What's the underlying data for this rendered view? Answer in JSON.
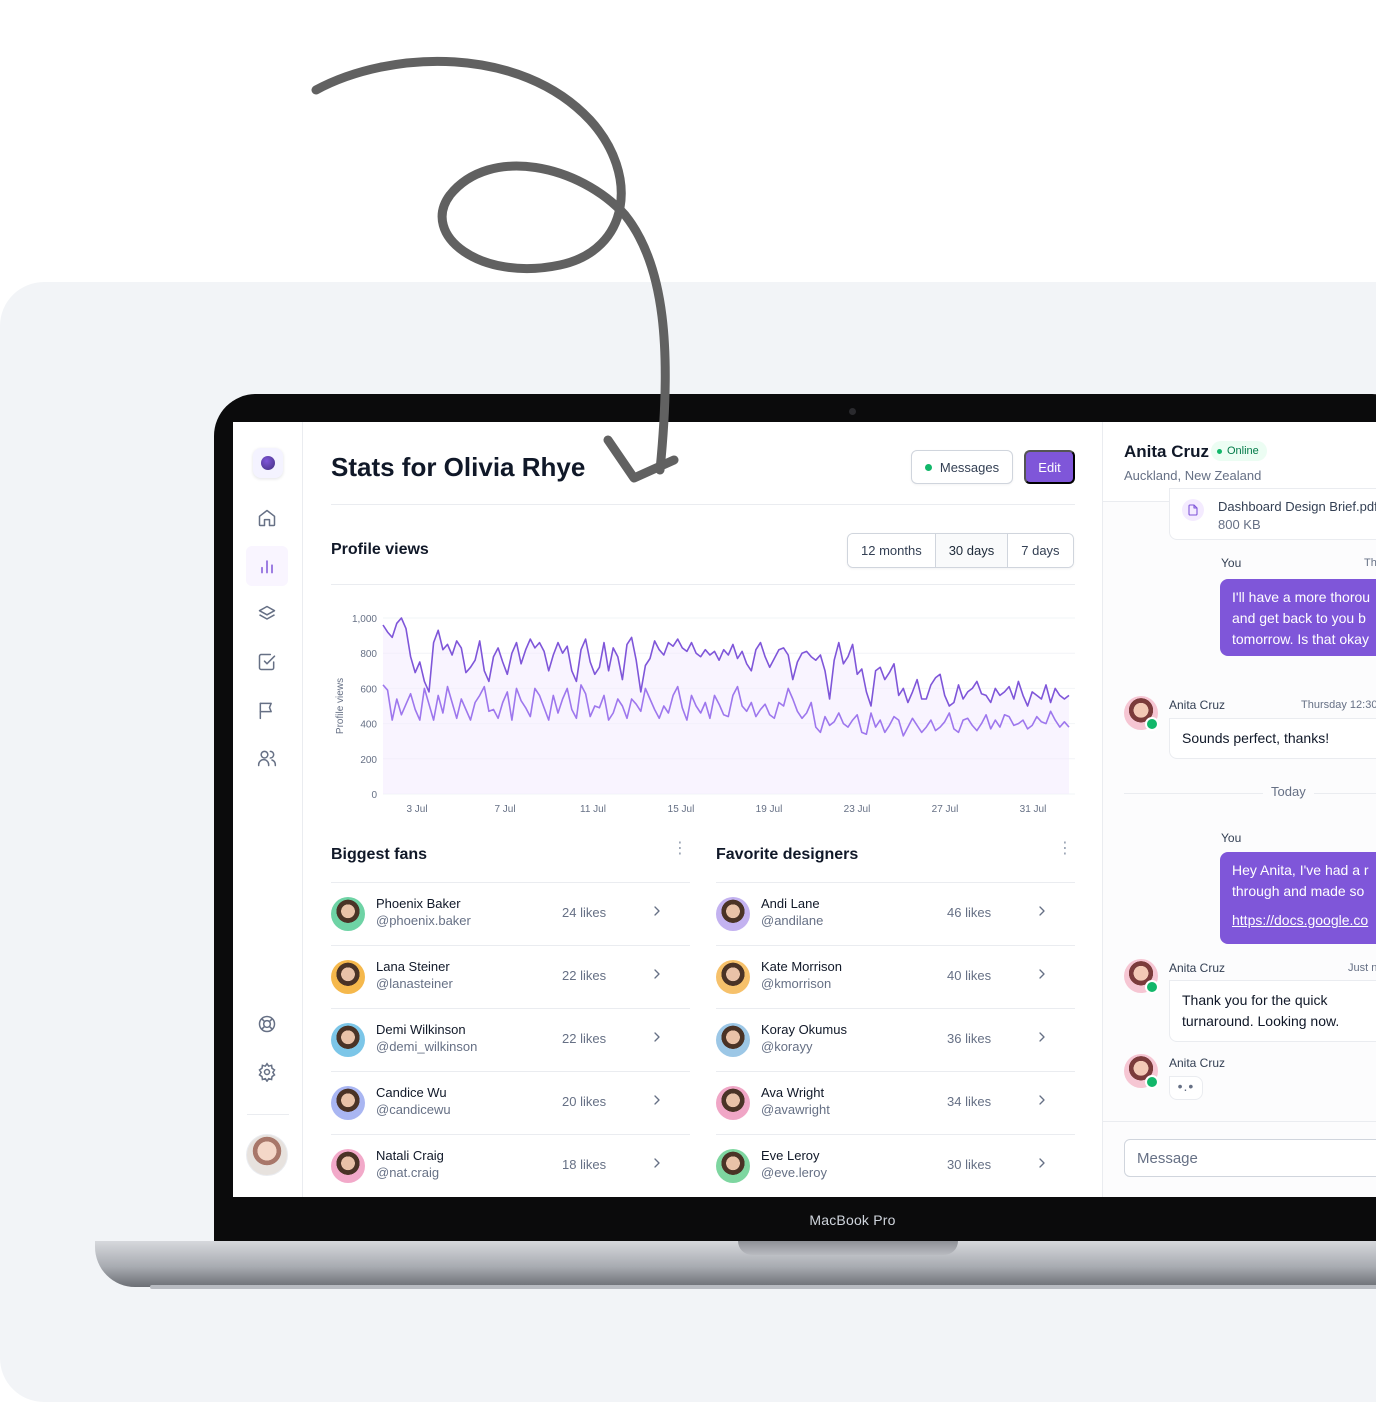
{
  "page": {
    "title": "Stats for Olivia Rhye",
    "messages_label": "Messages",
    "edit_label": "Edit"
  },
  "device": {
    "label": "MacBook Pro"
  },
  "sidebar": {
    "items": [
      {
        "name": "home",
        "icon": "home-icon"
      },
      {
        "name": "stats",
        "icon": "bar-chart-icon",
        "active": true
      },
      {
        "name": "layers",
        "icon": "layers-icon"
      },
      {
        "name": "tasks",
        "icon": "check-square-icon"
      },
      {
        "name": "reports",
        "icon": "flag-icon"
      },
      {
        "name": "users",
        "icon": "users-icon"
      }
    ],
    "footer_items": [
      {
        "name": "support",
        "icon": "life-buoy-icon"
      },
      {
        "name": "settings",
        "icon": "settings-icon"
      }
    ]
  },
  "profile_views": {
    "title": "Profile views",
    "ranges": [
      "12 months",
      "30 days",
      "7 days"
    ],
    "selected_range": "30 days"
  },
  "chart_data": {
    "type": "line",
    "ylabel": "Profile views",
    "ylim": [
      0,
      1000
    ],
    "yticks": [
      "0",
      "200",
      "400",
      "600",
      "800",
      "1,000"
    ],
    "xticks": [
      "3 Jul",
      "7 Jul",
      "11 Jul",
      "15 Jul",
      "19 Jul",
      "23 Jul",
      "27 Jul",
      "31 Jul"
    ],
    "x_start": "1 Jul",
    "x_end": "1 Aug",
    "colors": {
      "upper": "#7f56d9",
      "lower": "#9e77ed",
      "fill": "#f4ebff"
    },
    "series": [
      {
        "values": [
          960,
          920,
          890,
          970,
          1000,
          940,
          780,
          690,
          750,
          640,
          580,
          860,
          930,
          820,
          850,
          790,
          870,
          830,
          690,
          720,
          760,
          870,
          700,
          640,
          780,
          830,
          750,
          680,
          800,
          860,
          740,
          820,
          880,
          830,
          860,
          810,
          700,
          790,
          860,
          800,
          840,
          700,
          640,
          820,
          880,
          750,
          680,
          720,
          860,
          700,
          830,
          780,
          650,
          850,
          890,
          760,
          580,
          730,
          770,
          870,
          820,
          790,
          860,
          840,
          880,
          830,
          810,
          860,
          800,
          780,
          820,
          790,
          810,
          760,
          820,
          790,
          850,
          770,
          810,
          740,
          700,
          820,
          860,
          780,
          720,
          770,
          820,
          830,
          790,
          650,
          750,
          800,
          810,
          780,
          760,
          790,
          700,
          540,
          760,
          860,
          740,
          780,
          850,
          680,
          710,
          580,
          500,
          700,
          720,
          650,
          690,
          740,
          560,
          600,
          520,
          580,
          650,
          540,
          540,
          620,
          660,
          680,
          560,
          500,
          520,
          620,
          540,
          580,
          600,
          640,
          570,
          560,
          520,
          600,
          560,
          580,
          610,
          540,
          640,
          560,
          500,
          580,
          560,
          540,
          620,
          520,
          600,
          560,
          540,
          560
        ]
      },
      {
        "values": [
          620,
          590,
          420,
          540,
          450,
          510,
          570,
          480,
          420,
          600,
          510,
          420,
          560,
          460,
          610,
          520,
          430,
          540,
          480,
          420,
          520,
          560,
          610,
          470,
          480,
          430,
          520,
          580,
          420,
          600,
          530,
          490,
          440,
          600,
          560,
          490,
          420,
          560,
          460,
          540,
          600,
          480,
          430,
          620,
          570,
          440,
          500,
          490,
          560,
          420,
          460,
          540,
          500,
          430,
          540,
          510,
          470,
          600,
          540,
          480,
          430,
          500,
          460,
          560,
          610,
          490,
          420,
          560,
          500,
          460,
          520,
          430,
          560,
          510,
          450,
          440,
          560,
          610,
          500,
          470,
          520,
          440,
          480,
          510,
          450,
          430,
          520,
          500,
          600,
          540,
          470,
          430,
          460,
          520,
          380,
          350,
          440,
          390,
          410,
          460,
          400,
          380,
          420,
          450,
          350,
          340,
          460,
          380,
          420,
          350,
          390,
          440,
          420,
          330,
          380,
          430,
          390,
          350,
          380,
          420,
          360,
          380,
          410,
          460,
          370,
          350,
          420,
          430,
          390,
          360,
          400,
          450,
          370,
          420,
          380,
          450,
          440,
          390,
          400,
          420,
          370,
          390,
          440,
          410,
          400,
          470,
          420,
          380,
          410,
          380
        ]
      }
    ]
  },
  "biggest_fans": {
    "title": "Biggest fans",
    "rows": [
      {
        "name": "Phoenix Baker",
        "handle": "@phoenix.baker",
        "likes": "24 likes",
        "avatar_color": "#6ed3a5"
      },
      {
        "name": "Lana Steiner",
        "handle": "@lanasteiner",
        "likes": "22 likes",
        "avatar_color": "#f5b84c"
      },
      {
        "name": "Demi Wilkinson",
        "handle": "@demi_wilkinson",
        "likes": "22 likes",
        "avatar_color": "#7cc6e8"
      },
      {
        "name": "Candice Wu",
        "handle": "@candicewu",
        "likes": "20 likes",
        "avatar_color": "#a9b6f2"
      },
      {
        "name": "Natali Craig",
        "handle": "@nat.craig",
        "likes": "18 likes",
        "avatar_color": "#f2a9c9"
      }
    ]
  },
  "favorite_designers": {
    "title": "Favorite designers",
    "rows": [
      {
        "name": "Andi Lane",
        "handle": "@andilane",
        "likes": "46 likes",
        "avatar_color": "#c3b2f0"
      },
      {
        "name": "Kate Morrison",
        "handle": "@kmorrison",
        "likes": "40 likes",
        "avatar_color": "#f6c16b"
      },
      {
        "name": "Koray Okumus",
        "handle": "@korayy",
        "likes": "36 likes",
        "avatar_color": "#9cc7e6"
      },
      {
        "name": "Ava Wright",
        "handle": "@avawright",
        "likes": "34 likes",
        "avatar_color": "#f0a6c6"
      },
      {
        "name": "Eve Leroy",
        "handle": "@eve.leroy",
        "likes": "30 likes",
        "avatar_color": "#7ed6a0"
      }
    ]
  },
  "chat": {
    "contact_name": "Anita Cruz",
    "status": "Online",
    "location": "Auckland, New Zealand",
    "file": {
      "name": "Dashboard Design Brief.pdf",
      "size": "800 KB"
    },
    "you_label": "You",
    "msg1_time": "Th",
    "msg1_text_1": "I'll have a more thorou",
    "msg1_text_2": "and get back to you b",
    "msg1_text_3": "tomorrow. Is that okay",
    "reply1_sender": "Anita Cruz",
    "reply1_time": "Thursday 12:30",
    "reply1_text": "Sounds perfect, thanks!",
    "divider": "Today",
    "msg2_text_1": "Hey Anita, I've had a r",
    "msg2_text_2": "through and made so",
    "msg2_link": "https://docs.google.co",
    "reply2_sender": "Anita Cruz",
    "reply2_time": "Just n",
    "reply2_text_1": "Thank you for the quick",
    "reply2_text_2": "turnaround. Looking now.",
    "typing_sender": "Anita Cruz",
    "typing": "•.•",
    "input_placeholder": "Message"
  }
}
